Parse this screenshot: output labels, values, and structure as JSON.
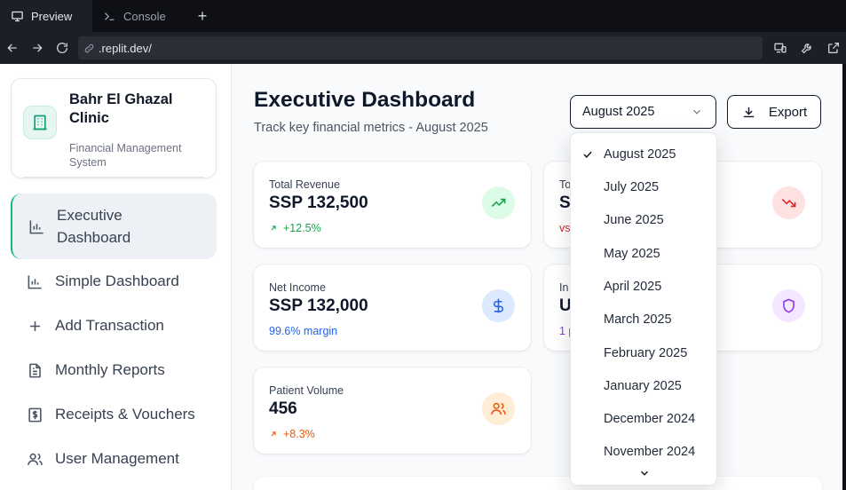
{
  "browser": {
    "tabs": [
      {
        "label": "Preview",
        "icon": "monitor-icon"
      },
      {
        "label": "Console",
        "icon": "terminal-icon"
      }
    ],
    "new_tab": "+",
    "url": ".replit.dev/"
  },
  "sidebar": {
    "brand_name": "Bahr El Ghazal Clinic",
    "brand_subtitle": "Financial Management System",
    "items": [
      {
        "label": "Executive Dashboard",
        "icon": "bar-chart-icon"
      },
      {
        "label": "Simple Dashboard",
        "icon": "bar-chart-icon"
      },
      {
        "label": "Add Transaction",
        "icon": "plus-icon"
      },
      {
        "label": "Monthly Reports",
        "icon": "document-icon"
      },
      {
        "label": "Receipts & Vouchers",
        "icon": "receipt-dollar-icon"
      },
      {
        "label": "User Management",
        "icon": "users-icon"
      }
    ]
  },
  "header": {
    "title": "Executive Dashboard",
    "subtitle": "Track key financial metrics - August 2025",
    "month_selected": "August 2025",
    "export_label": "Export"
  },
  "cards": {
    "total_revenue": {
      "label": "Total Revenue",
      "value": "SSP 132,500",
      "change": "+12.5%",
      "color": "#16a34a"
    },
    "net_income": {
      "label": "Net Income",
      "value": "SSP 132,000",
      "note": "99.6% margin",
      "color": "#2563eb"
    },
    "patient_volume": {
      "label": "Patient Volume",
      "value": "456",
      "change": "+8.3%",
      "color": "#ea580c"
    },
    "partial_top": {
      "label": "To",
      "value": "S",
      "note": "vs",
      "color": "#dc2626"
    },
    "partial_mid": {
      "label": "In",
      "value": "U",
      "note": "1 p",
      "color": "#9333ea"
    }
  },
  "dropdown": {
    "options": [
      "August 2025",
      "July 2025",
      "June 2025",
      "May 2025",
      "April 2025",
      "March 2025",
      "February 2025",
      "January 2025",
      "December 2024",
      "November 2024"
    ],
    "selected": "August 2025"
  }
}
